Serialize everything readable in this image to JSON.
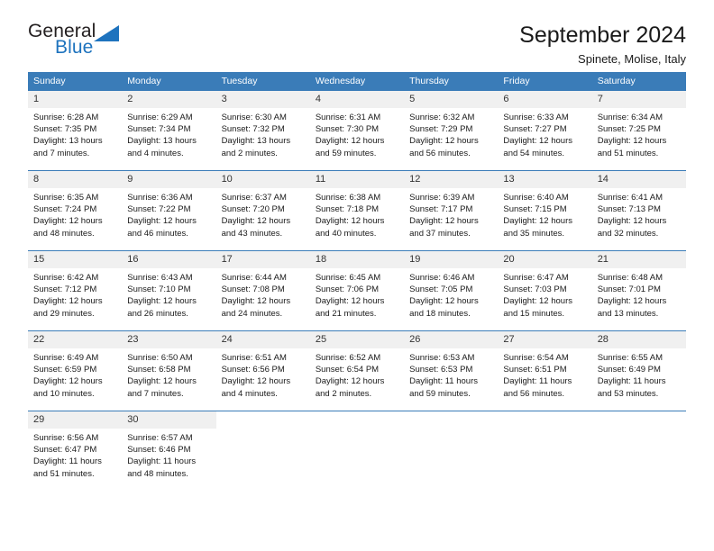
{
  "brand": {
    "name_top": "General",
    "name_bottom": "Blue",
    "triangle_color": "#1e73be",
    "text_color": "#231f20"
  },
  "header": {
    "title": "September 2024",
    "subtitle": "Spinete, Molise, Italy"
  },
  "theme": {
    "header_bg": "#3a7cb8",
    "header_text": "#ffffff",
    "daynum_bg": "#f0f0f0",
    "cell_bg": "#ffffff",
    "row_divider": "#3a7cb8"
  },
  "calendar": {
    "weekday_headers": [
      "Sunday",
      "Monday",
      "Tuesday",
      "Wednesday",
      "Thursday",
      "Friday",
      "Saturday"
    ],
    "weeks": [
      [
        {
          "day": "1",
          "sunrise": "Sunrise: 6:28 AM",
          "sunset": "Sunset: 7:35 PM",
          "daylight_line1": "Daylight: 13 hours",
          "daylight_line2": "and 7 minutes."
        },
        {
          "day": "2",
          "sunrise": "Sunrise: 6:29 AM",
          "sunset": "Sunset: 7:34 PM",
          "daylight_line1": "Daylight: 13 hours",
          "daylight_line2": "and 4 minutes."
        },
        {
          "day": "3",
          "sunrise": "Sunrise: 6:30 AM",
          "sunset": "Sunset: 7:32 PM",
          "daylight_line1": "Daylight: 13 hours",
          "daylight_line2": "and 2 minutes."
        },
        {
          "day": "4",
          "sunrise": "Sunrise: 6:31 AM",
          "sunset": "Sunset: 7:30 PM",
          "daylight_line1": "Daylight: 12 hours",
          "daylight_line2": "and 59 minutes."
        },
        {
          "day": "5",
          "sunrise": "Sunrise: 6:32 AM",
          "sunset": "Sunset: 7:29 PM",
          "daylight_line1": "Daylight: 12 hours",
          "daylight_line2": "and 56 minutes."
        },
        {
          "day": "6",
          "sunrise": "Sunrise: 6:33 AM",
          "sunset": "Sunset: 7:27 PM",
          "daylight_line1": "Daylight: 12 hours",
          "daylight_line2": "and 54 minutes."
        },
        {
          "day": "7",
          "sunrise": "Sunrise: 6:34 AM",
          "sunset": "Sunset: 7:25 PM",
          "daylight_line1": "Daylight: 12 hours",
          "daylight_line2": "and 51 minutes."
        }
      ],
      [
        {
          "day": "8",
          "sunrise": "Sunrise: 6:35 AM",
          "sunset": "Sunset: 7:24 PM",
          "daylight_line1": "Daylight: 12 hours",
          "daylight_line2": "and 48 minutes."
        },
        {
          "day": "9",
          "sunrise": "Sunrise: 6:36 AM",
          "sunset": "Sunset: 7:22 PM",
          "daylight_line1": "Daylight: 12 hours",
          "daylight_line2": "and 46 minutes."
        },
        {
          "day": "10",
          "sunrise": "Sunrise: 6:37 AM",
          "sunset": "Sunset: 7:20 PM",
          "daylight_line1": "Daylight: 12 hours",
          "daylight_line2": "and 43 minutes."
        },
        {
          "day": "11",
          "sunrise": "Sunrise: 6:38 AM",
          "sunset": "Sunset: 7:18 PM",
          "daylight_line1": "Daylight: 12 hours",
          "daylight_line2": "and 40 minutes."
        },
        {
          "day": "12",
          "sunrise": "Sunrise: 6:39 AM",
          "sunset": "Sunset: 7:17 PM",
          "daylight_line1": "Daylight: 12 hours",
          "daylight_line2": "and 37 minutes."
        },
        {
          "day": "13",
          "sunrise": "Sunrise: 6:40 AM",
          "sunset": "Sunset: 7:15 PM",
          "daylight_line1": "Daylight: 12 hours",
          "daylight_line2": "and 35 minutes."
        },
        {
          "day": "14",
          "sunrise": "Sunrise: 6:41 AM",
          "sunset": "Sunset: 7:13 PM",
          "daylight_line1": "Daylight: 12 hours",
          "daylight_line2": "and 32 minutes."
        }
      ],
      [
        {
          "day": "15",
          "sunrise": "Sunrise: 6:42 AM",
          "sunset": "Sunset: 7:12 PM",
          "daylight_line1": "Daylight: 12 hours",
          "daylight_line2": "and 29 minutes."
        },
        {
          "day": "16",
          "sunrise": "Sunrise: 6:43 AM",
          "sunset": "Sunset: 7:10 PM",
          "daylight_line1": "Daylight: 12 hours",
          "daylight_line2": "and 26 minutes."
        },
        {
          "day": "17",
          "sunrise": "Sunrise: 6:44 AM",
          "sunset": "Sunset: 7:08 PM",
          "daylight_line1": "Daylight: 12 hours",
          "daylight_line2": "and 24 minutes."
        },
        {
          "day": "18",
          "sunrise": "Sunrise: 6:45 AM",
          "sunset": "Sunset: 7:06 PM",
          "daylight_line1": "Daylight: 12 hours",
          "daylight_line2": "and 21 minutes."
        },
        {
          "day": "19",
          "sunrise": "Sunrise: 6:46 AM",
          "sunset": "Sunset: 7:05 PM",
          "daylight_line1": "Daylight: 12 hours",
          "daylight_line2": "and 18 minutes."
        },
        {
          "day": "20",
          "sunrise": "Sunrise: 6:47 AM",
          "sunset": "Sunset: 7:03 PM",
          "daylight_line1": "Daylight: 12 hours",
          "daylight_line2": "and 15 minutes."
        },
        {
          "day": "21",
          "sunrise": "Sunrise: 6:48 AM",
          "sunset": "Sunset: 7:01 PM",
          "daylight_line1": "Daylight: 12 hours",
          "daylight_line2": "and 13 minutes."
        }
      ],
      [
        {
          "day": "22",
          "sunrise": "Sunrise: 6:49 AM",
          "sunset": "Sunset: 6:59 PM",
          "daylight_line1": "Daylight: 12 hours",
          "daylight_line2": "and 10 minutes."
        },
        {
          "day": "23",
          "sunrise": "Sunrise: 6:50 AM",
          "sunset": "Sunset: 6:58 PM",
          "daylight_line1": "Daylight: 12 hours",
          "daylight_line2": "and 7 minutes."
        },
        {
          "day": "24",
          "sunrise": "Sunrise: 6:51 AM",
          "sunset": "Sunset: 6:56 PM",
          "daylight_line1": "Daylight: 12 hours",
          "daylight_line2": "and 4 minutes."
        },
        {
          "day": "25",
          "sunrise": "Sunrise: 6:52 AM",
          "sunset": "Sunset: 6:54 PM",
          "daylight_line1": "Daylight: 12 hours",
          "daylight_line2": "and 2 minutes."
        },
        {
          "day": "26",
          "sunrise": "Sunrise: 6:53 AM",
          "sunset": "Sunset: 6:53 PM",
          "daylight_line1": "Daylight: 11 hours",
          "daylight_line2": "and 59 minutes."
        },
        {
          "day": "27",
          "sunrise": "Sunrise: 6:54 AM",
          "sunset": "Sunset: 6:51 PM",
          "daylight_line1": "Daylight: 11 hours",
          "daylight_line2": "and 56 minutes."
        },
        {
          "day": "28",
          "sunrise": "Sunrise: 6:55 AM",
          "sunset": "Sunset: 6:49 PM",
          "daylight_line1": "Daylight: 11 hours",
          "daylight_line2": "and 53 minutes."
        }
      ],
      [
        {
          "day": "29",
          "sunrise": "Sunrise: 6:56 AM",
          "sunset": "Sunset: 6:47 PM",
          "daylight_line1": "Daylight: 11 hours",
          "daylight_line2": "and 51 minutes."
        },
        {
          "day": "30",
          "sunrise": "Sunrise: 6:57 AM",
          "sunset": "Sunset: 6:46 PM",
          "daylight_line1": "Daylight: 11 hours",
          "daylight_line2": "and 48 minutes."
        },
        {
          "day": "",
          "sunrise": "",
          "sunset": "",
          "daylight_line1": "",
          "daylight_line2": ""
        },
        {
          "day": "",
          "sunrise": "",
          "sunset": "",
          "daylight_line1": "",
          "daylight_line2": ""
        },
        {
          "day": "",
          "sunrise": "",
          "sunset": "",
          "daylight_line1": "",
          "daylight_line2": ""
        },
        {
          "day": "",
          "sunrise": "",
          "sunset": "",
          "daylight_line1": "",
          "daylight_line2": ""
        },
        {
          "day": "",
          "sunrise": "",
          "sunset": "",
          "daylight_line1": "",
          "daylight_line2": ""
        }
      ]
    ]
  }
}
